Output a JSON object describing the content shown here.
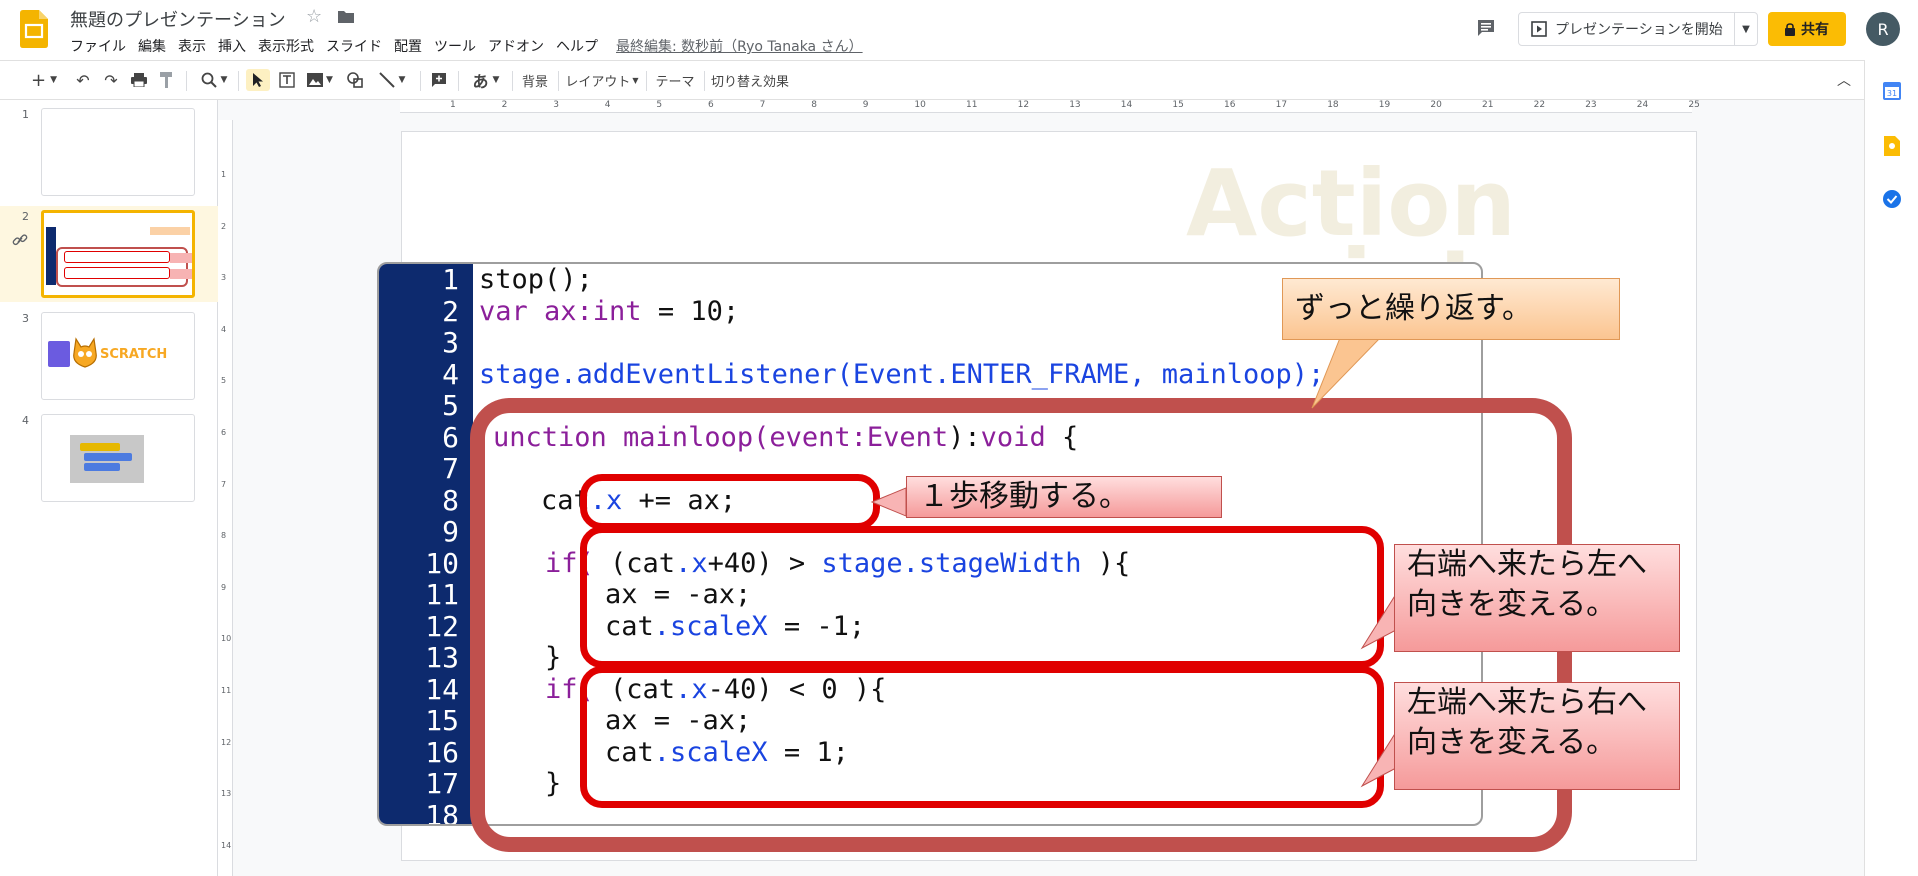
{
  "header": {
    "doc_title": "無題のプレゼンテーション",
    "menu": [
      "ファイル",
      "編集",
      "表示",
      "挿入",
      "表示形式",
      "スライド",
      "配置",
      "ツール",
      "アドオン",
      "ヘルプ"
    ],
    "last_edit": "最終編集: 数秒前（Ryo Tanaka さん）",
    "present_label": "プレゼンテーションを開始",
    "share_label": "共有",
    "avatar_initial": "R"
  },
  "toolbar": {
    "add": "+",
    "ime": "あ",
    "background": "背景",
    "layout": "レイアウト",
    "theme": "テーマ",
    "transition": "切り替え効果"
  },
  "ruler": {
    "h_ticks": [
      "1",
      "2",
      "3",
      "4",
      "5",
      "6",
      "7",
      "8",
      "9",
      "10",
      "11",
      "12",
      "13",
      "14",
      "15",
      "16",
      "17",
      "18",
      "19",
      "20",
      "21",
      "22",
      "23",
      "24",
      "25"
    ],
    "v_ticks": [
      "1",
      "2",
      "3",
      "4",
      "5",
      "6",
      "7",
      "8",
      "9",
      "10",
      "11",
      "12",
      "13",
      "14"
    ]
  },
  "filmstrip": {
    "slides": [
      {
        "num": "1"
      },
      {
        "num": "2",
        "selected": true
      },
      {
        "num": "3",
        "thumb_text": "SCRATCH"
      },
      {
        "num": "4"
      }
    ]
  },
  "slide": {
    "watermark": "Action script",
    "code": {
      "line_numbers": [
        "1",
        "2",
        "3",
        "4",
        "5",
        "6",
        "7",
        "8",
        "9",
        "10",
        "11",
        "12",
        "13",
        "14",
        "15",
        "16",
        "17",
        "18"
      ],
      "l1": "stop();",
      "l2a": "var ax:",
      "l2b": "int",
      "l2c": " = 10;",
      "l4a": "stage.addEventListener(Event.ENTER_FRAME, mainloop);",
      "l6a": "unction mainloop(event:",
      "l6b": "Event",
      "l6c": "):",
      "l6d": "void",
      "l6e": " {",
      "l8a": "cat",
      "l8b": ".x",
      "l8c": " += ax;",
      "l10a": "if(",
      "l10b": " (cat",
      "l10c": ".x",
      "l10d": "+40) > ",
      "l10e": "stage.stageWidth",
      "l10f": " ){",
      "l11": "ax = -ax;",
      "l12a": "cat",
      "l12b": ".scaleX",
      "l12c": " = -1;",
      "l13": "}",
      "l14a": "if(",
      "l14b": " (cat",
      "l14c": ".x",
      "l14d": "-40) < 0 ){",
      "l15": "ax = -ax;",
      "l16a": "cat",
      "l16b": ".scaleX",
      "l16c": " = 1;",
      "l17": "}"
    },
    "callouts": {
      "loop": "ずっと繰り返す。",
      "step": "１歩移動する。",
      "right_edge": "右端へ来たら左へ向きを変える。",
      "left_edge": "左端へ来たら右へ向きを変える。"
    }
  },
  "colors": {
    "accent": "#fbbc04",
    "gutter": "#0d2a6e",
    "loop_frame": "#c0504d",
    "frame_red": "#e00000",
    "keyword": "#8b1f9a",
    "member": "#1a44e0"
  },
  "icons": [
    "slides-logo",
    "star-icon",
    "folder-icon",
    "comment-icon",
    "present-icon",
    "lock-icon",
    "undo-icon",
    "redo-icon",
    "print-icon",
    "paint-format-icon",
    "zoom-icon",
    "cursor-icon",
    "textbox-icon",
    "image-icon",
    "shape-icon",
    "line-icon",
    "comment-add-icon",
    "collapse-icon",
    "calendar-icon",
    "keep-icon",
    "tasks-icon"
  ]
}
